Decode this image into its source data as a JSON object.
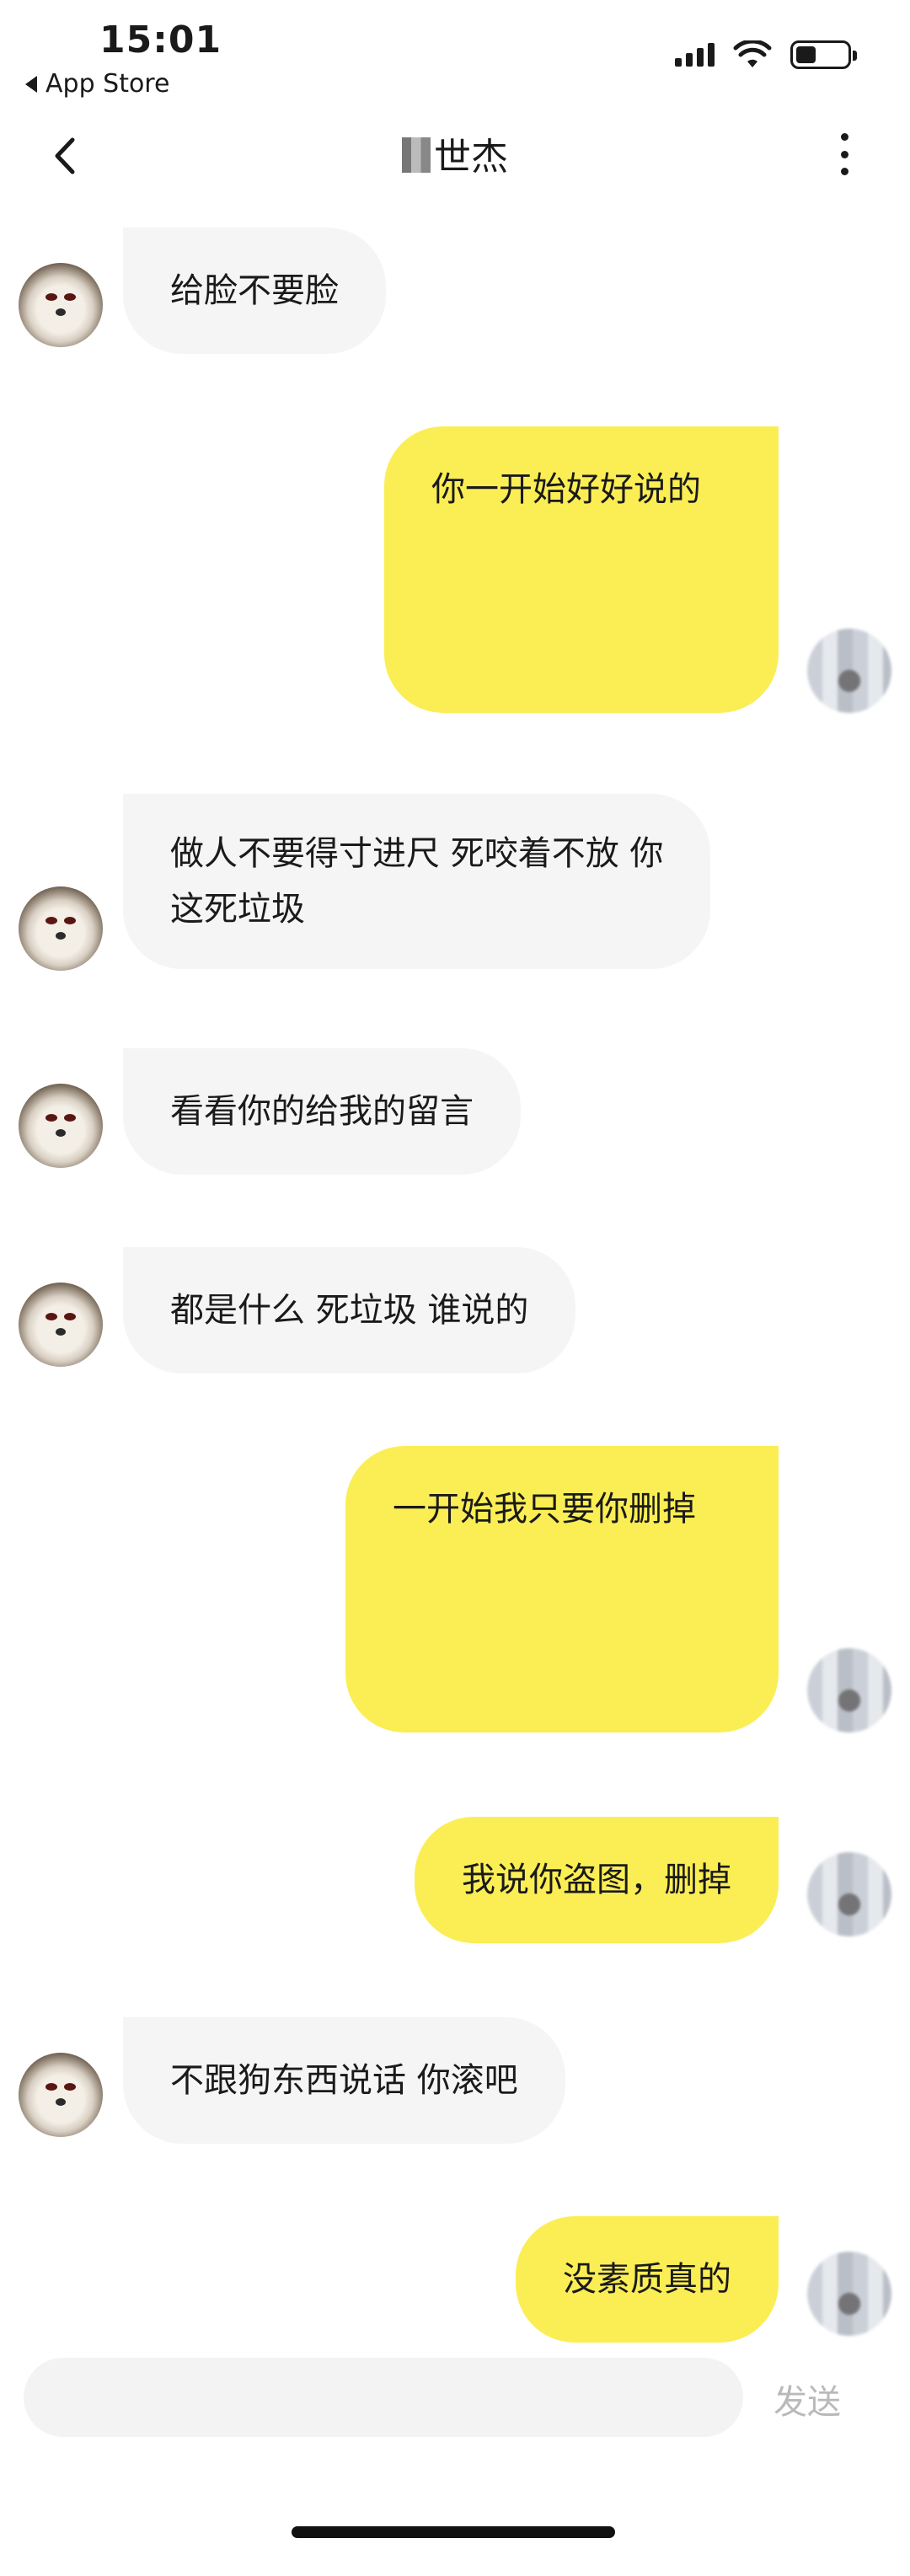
{
  "status_bar": {
    "time": "15:01",
    "back_app": "App Store"
  },
  "nav": {
    "title": "世杰"
  },
  "messages": [
    {
      "side": "in",
      "text": "给脸不要脸"
    },
    {
      "side": "out",
      "text": "你一开始好好说的"
    },
    {
      "side": "in",
      "text": "做人不要得寸进尺 死咬着不放 你\n这死垃圾"
    },
    {
      "side": "in",
      "text": "看看你的给我的留言"
    },
    {
      "side": "in",
      "text": "都是什么 死垃圾 谁说的"
    },
    {
      "side": "out",
      "text": "一开始我只要你删掉"
    },
    {
      "side": "out",
      "text": "我说你盗图，删掉"
    },
    {
      "side": "in",
      "text": "不跟狗东西说话 你滚吧"
    },
    {
      "side": "out",
      "text": "没素质真的"
    }
  ],
  "input": {
    "placeholder": "",
    "send_label": "发送"
  },
  "colors": {
    "outgoing_bubble": "#fbee55",
    "incoming_bubble": "#f5f5f5",
    "send_disabled": "#b9b9b9"
  }
}
